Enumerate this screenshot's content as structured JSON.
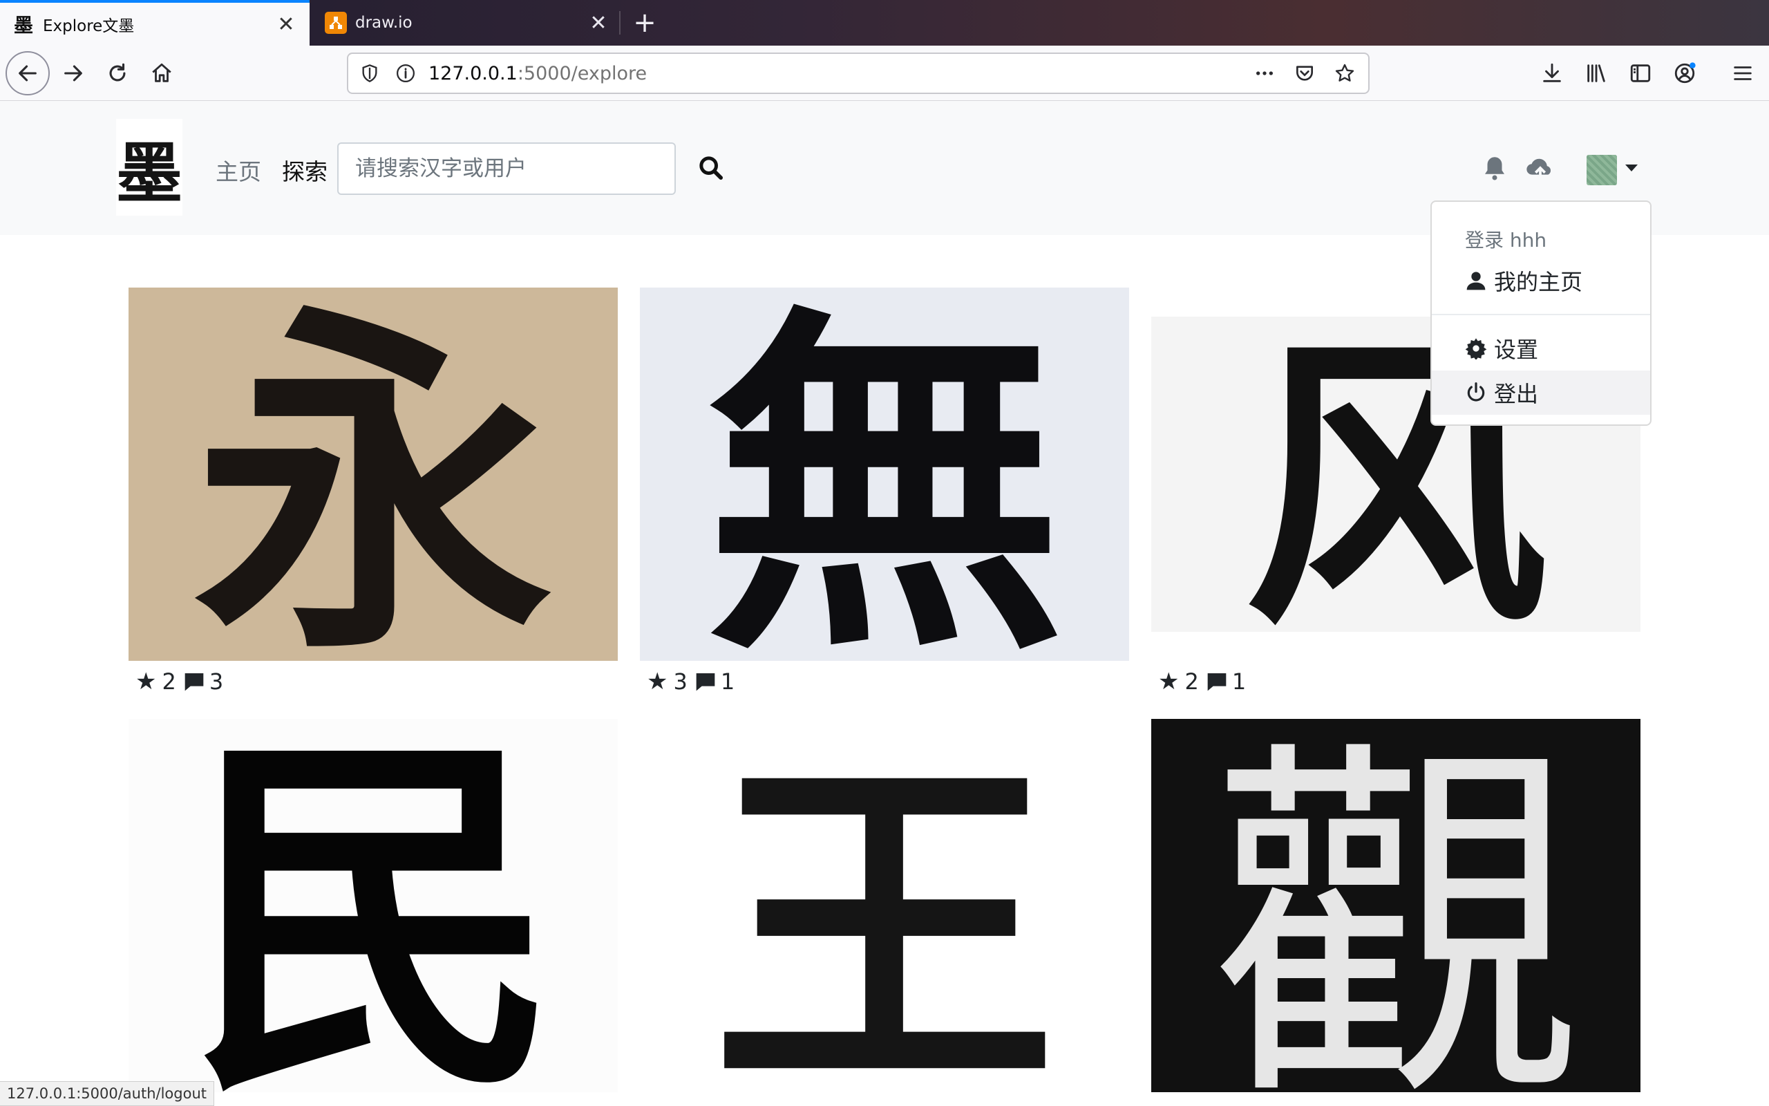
{
  "browser": {
    "tabs": [
      {
        "title": "Explore文墨",
        "favicon": "墨",
        "active": true
      },
      {
        "title": "draw.io",
        "favicon": "drawio-icon",
        "active": false
      }
    ],
    "url": {
      "host": "127.0.0.1",
      "path": ":5000/explore"
    },
    "status_text": "127.0.0.1:5000/auth/logout"
  },
  "site": {
    "logo_text": "墨",
    "nav": {
      "home": "主页",
      "explore": "探索"
    },
    "search": {
      "placeholder": "请搜索汉字或用户"
    },
    "dropdown": {
      "header": "登录 hhh",
      "items": [
        {
          "label": "我的主页",
          "icon": "user-icon"
        },
        {
          "label": "设置",
          "icon": "gear-icon"
        },
        {
          "label": "登出",
          "icon": "power-icon"
        }
      ]
    }
  },
  "posts": [
    {
      "character": "永",
      "stars": "2",
      "comments": "3",
      "bg": "#cdb89a",
      "ink": "#1a1512"
    },
    {
      "character": "無",
      "stars": "3",
      "comments": "1",
      "bg": "#e8ebf2",
      "ink": "#0d0d10"
    },
    {
      "character": "风",
      "stars": "2",
      "comments": "1",
      "bg": "#f4f4f4",
      "ink": "#111111"
    },
    {
      "character": "民",
      "bg": "#fcfcfc",
      "ink": "#050505"
    },
    {
      "character": "王",
      "bg": "#ffffff",
      "ink": "#151515"
    },
    {
      "character": "觀",
      "bg": "#111111",
      "ink": "#e6e6e6"
    }
  ]
}
